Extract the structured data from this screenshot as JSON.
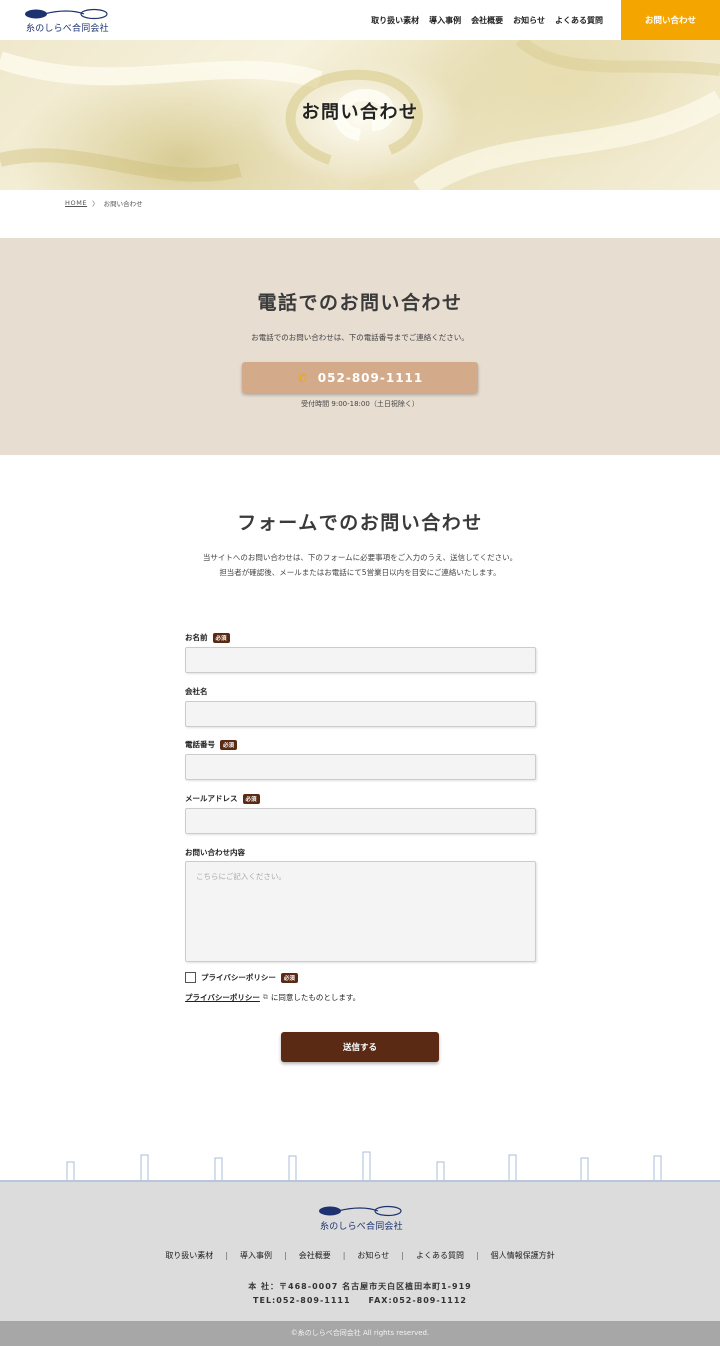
{
  "header": {
    "logo_text": "糸のしらべ合同会社",
    "nav": [
      "取り扱い素材",
      "導入事例",
      "会社概要",
      "お知らせ",
      "よくある質問"
    ],
    "cta": "お問い合わせ"
  },
  "hero": {
    "title": "お問い合わせ"
  },
  "breadcrumb": {
    "home": "HOME",
    "sep": "〉",
    "current": "お問い合わせ"
  },
  "phone": {
    "title": "電話でのお問い合わせ",
    "desc": "お電話でのお問い合わせは、下の電話番号までご連絡ください。",
    "number": "052-809-1111",
    "icon": "phone-icon",
    "hours": "受付時間 9:00-18:00（土日祝除く）"
  },
  "form": {
    "title": "フォームでのお問い合わせ",
    "intro_line1": "当サイトへのお問い合わせは、下のフォームに必要事項をご入力のうえ、送信してください。",
    "intro_line2": "担当者が確認後、メールまたはお電話にて5営業日以内を目安にご連絡いたします。",
    "required_badge": "必須",
    "fields": {
      "name": "お名前",
      "company": "会社名",
      "tel": "電話番号",
      "email": "メールアドレス",
      "message": "お問い合わせ内容"
    },
    "message_placeholder": "こちらにご記入ください。",
    "privacy_label": "プライバシーポリシー",
    "privacy_link": "プライバシーポリシー",
    "agree_text": "に同意したものとします。",
    "submit": "送信する"
  },
  "footer": {
    "logo_text": "糸のしらべ合同会社",
    "nav": [
      "取り扱い素材",
      "導入事例",
      "会社概要",
      "お知らせ",
      "よくある質問",
      "個人情報保護方針"
    ],
    "address": "本 社：〒468-0007 名古屋市天白区植田本町1-919",
    "contact": "TEL:052-809-1111　　FAX:052-809-1112",
    "copyright": "©糸のしらべ合同会社 All rights reserved."
  },
  "colors": {
    "accent_orange": "#f5a500",
    "brand_navy": "#1d3270",
    "phone_bg": "#e7ddd1",
    "phone_button": "#d4ab8a",
    "brown": "#5a2a14"
  }
}
